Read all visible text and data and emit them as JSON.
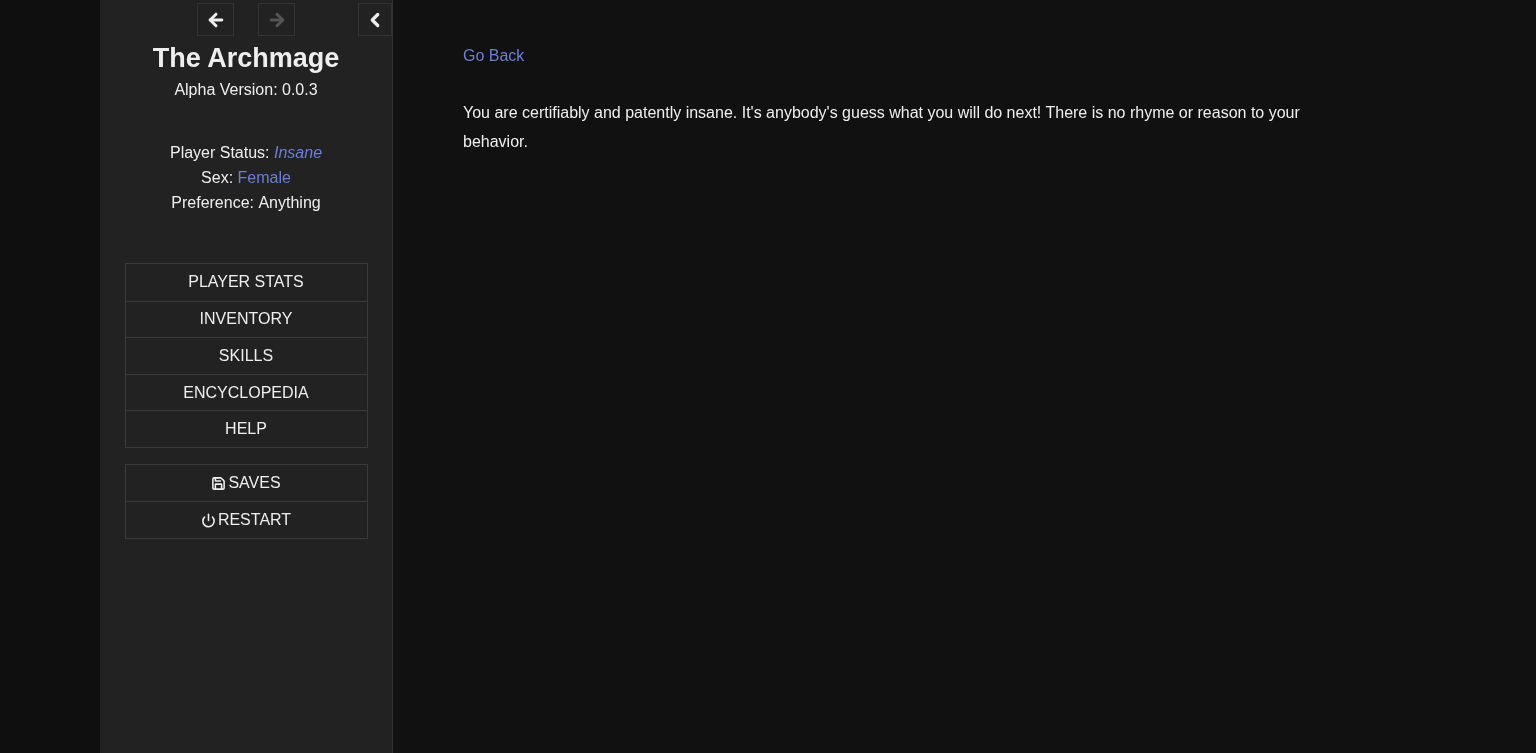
{
  "history": [
    {
      "kind": "back",
      "disabled": false
    },
    {
      "kind": "forward",
      "disabled": true
    }
  ],
  "sidebar": {
    "title": "The Archmage",
    "version": "Alpha Version: 0.0.3",
    "status": [
      {
        "label": "Player Status: ",
        "value": "Insane",
        "kind": "italic"
      },
      {
        "label": "Sex: ",
        "value": "Female",
        "kind": "link"
      },
      {
        "label": "Preference: ",
        "value": "Anything",
        "kind": "plain"
      }
    ],
    "menu": [
      {
        "label": "PLAYER STATS"
      },
      {
        "label": "INVENTORY"
      },
      {
        "label": "SKILLS"
      },
      {
        "label": "ENCYCLOPEDIA"
      },
      {
        "label": "HELP"
      }
    ],
    "system_menu": [
      {
        "label": "SAVES",
        "kind": "save"
      },
      {
        "label": "RESTART",
        "kind": "restart"
      }
    ]
  },
  "main": {
    "link": "Go Back",
    "text": "You are certifiably and patently insane. It's anybody's guess what you will do next! There is no rhyme or reason to your behavior."
  }
}
